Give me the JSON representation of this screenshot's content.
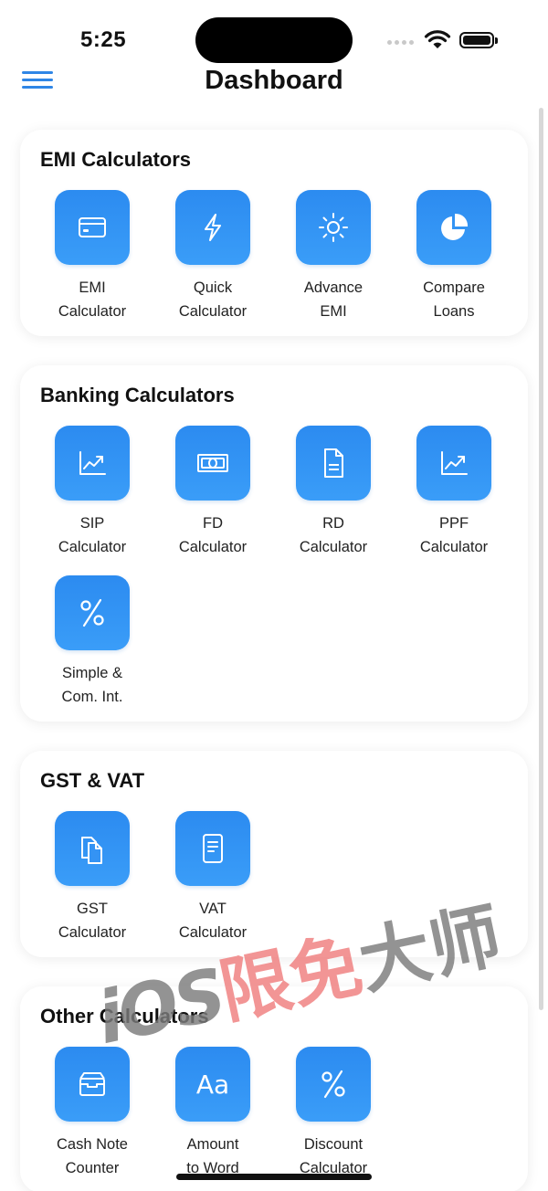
{
  "status_bar": {
    "time": "5:25"
  },
  "nav": {
    "title": "Dashboard",
    "menu_icon": "hamburger-menu-icon"
  },
  "sections": [
    {
      "title": "EMI Calculators",
      "items": [
        {
          "label": "EMI\nCalculator",
          "icon": "credit-card-icon"
        },
        {
          "label": "Quick\nCalculator",
          "icon": "bolt-icon"
        },
        {
          "label": "Advance\nEMI",
          "icon": "sun-icon"
        },
        {
          "label": "Compare\nLoans",
          "icon": "pie-chart-icon"
        }
      ]
    },
    {
      "title": "Banking Calculators",
      "items": [
        {
          "label": "SIP\nCalculator",
          "icon": "chart-line-up-icon"
        },
        {
          "label": "FD\nCalculator",
          "icon": "banknote-icon"
        },
        {
          "label": "RD\nCalculator",
          "icon": "document-icon"
        },
        {
          "label": "PPF\nCalculator",
          "icon": "chart-line-up-icon"
        },
        {
          "label": "Simple &\nCom. Int.",
          "icon": "percent-icon"
        }
      ]
    },
    {
      "title": "GST & VAT",
      "items": [
        {
          "label": "GST\nCalculator",
          "icon": "documents-icon"
        },
        {
          "label": "VAT\nCalculator",
          "icon": "list-document-icon"
        }
      ]
    },
    {
      "title": "Other Calculators",
      "items": [
        {
          "label": "Cash Note\nCounter",
          "icon": "tray-icon"
        },
        {
          "label": "Amount\nto Word",
          "icon": "text-format-icon"
        },
        {
          "label": "Discount\nCalculator",
          "icon": "percent-icon"
        }
      ]
    }
  ],
  "watermark": {
    "part1": "iOS",
    "part2": "限免",
    "part3": "大师"
  },
  "colors": {
    "accent": "#2f86e6",
    "tile_gradient_top": "#2c8bf0",
    "tile_gradient_bottom": "#3a9df8"
  }
}
